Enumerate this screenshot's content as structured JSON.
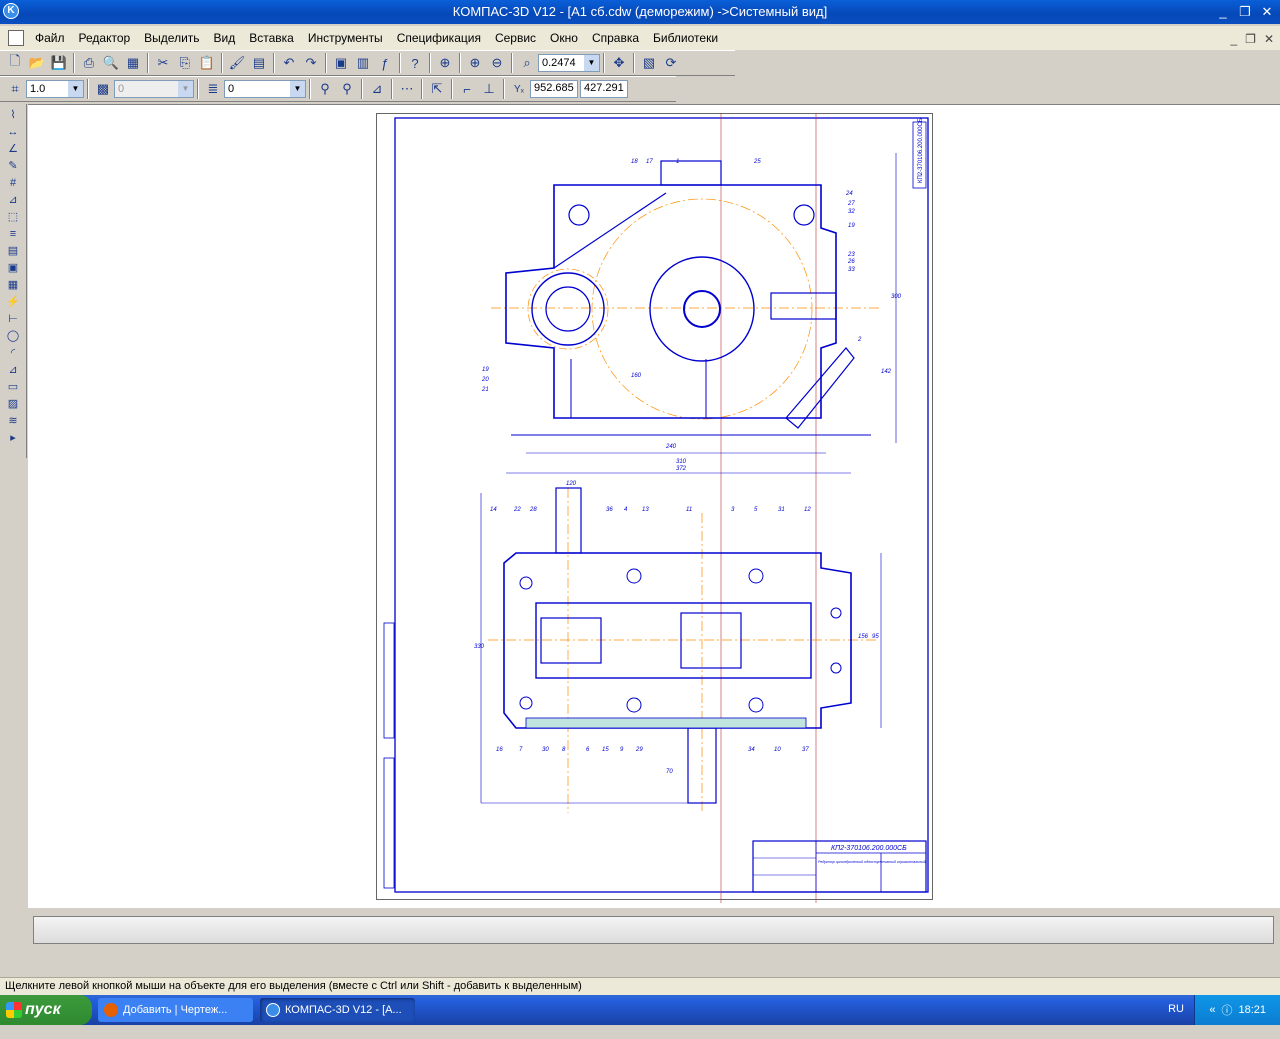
{
  "window": {
    "title": "КОМПАС-3D V12 - [А1 сб.cdw (деморежим) ->Системный вид]",
    "app_icon": "K"
  },
  "window_buttons": {
    "minimize": "_",
    "restore": "❐",
    "close": "✕"
  },
  "menu": {
    "items": [
      "Файл",
      "Редактор",
      "Выделить",
      "Вид",
      "Вставка",
      "Инструменты",
      "Спецификация",
      "Сервис",
      "Окно",
      "Справка",
      "Библиотеки"
    ]
  },
  "toolbar": {
    "zoom_value": "0.2474",
    "style_value": "1.0",
    "layer_disabled_value": "0",
    "layer_value": "0",
    "coord_x": "952.685",
    "coord_y": "427.291",
    "coord_label": "Yₓ"
  },
  "drawing": {
    "stamp_title": "КП2-370106.200.000СБ",
    "stamp_text": "Редуктор цилиндрический одноступенчатый горизонтальный",
    "side_stamp": "КП2-370106.200.000СБ",
    "dims_top": [
      "160",
      "240",
      "310",
      "372",
      "300",
      "142"
    ],
    "dims_bottom": [
      "120",
      "330",
      "156",
      "95",
      "70"
    ],
    "pos_labels_top": [
      "18",
      "17",
      "1",
      "25",
      "24",
      "27",
      "32",
      "19",
      "23",
      "26",
      "33",
      "2",
      "19",
      "20",
      "21"
    ],
    "pos_labels_bottom": [
      "14",
      "22",
      "28",
      "36",
      "4",
      "13",
      "11",
      "3",
      "5",
      "31",
      "12",
      "16",
      "7",
      "30",
      "8",
      "6",
      "15",
      "9",
      "29",
      "34",
      "10",
      "37"
    ]
  },
  "status": {
    "hint": "Щелкните левой кнопкой мыши на объекте для его выделения (вместе с Ctrl или Shift - добавить к выделенным)"
  },
  "taskbar": {
    "start_label": "пуск",
    "tasks": [
      "Добавить | Чертеж...",
      "КОМПАС-3D V12 - [А..."
    ],
    "lang": "RU",
    "clock": "18:21"
  },
  "colors": {
    "drawing_line": "#0000d0",
    "axis_line": "#ff8c00",
    "titlebar": "#0a5fd8"
  }
}
